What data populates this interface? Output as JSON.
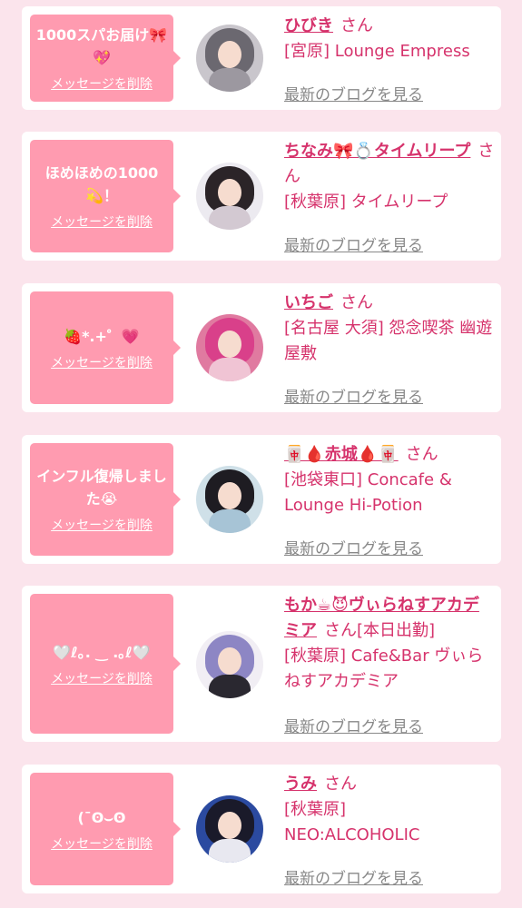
{
  "colors": {
    "background": "#fbe4ec",
    "bubble": "#ff9bb0",
    "accent": "#d6336c",
    "blog_link": "#888888"
  },
  "delete_label": "メッセージを削除",
  "san_label": "さん",
  "blog_label": "最新のブログを見る",
  "cards": [
    {
      "message": "1000スパお届け🎀💖",
      "name": "ひびき",
      "shop": "[宮原] Lounge Empress",
      "avatar": {
        "bg": "#c9c6cc",
        "hair": "#6b6870",
        "body": "#9c98a0"
      }
    },
    {
      "message": "ほめほめの1000💫！",
      "name": "ちなみ🎀💍タイムリープ",
      "shop": "[秋葉原] タイムリープ",
      "avatar": {
        "bg": "#eceaf0",
        "hair": "#2b2428",
        "body": "#d3c9d2"
      }
    },
    {
      "message": "🍓*.+゜💗",
      "name": "いちご",
      "shop": "[名古屋 大須] 怨念喫茶 幽遊屋敷",
      "avatar": {
        "bg": "#e07aa0",
        "hair": "#d9408a",
        "body": "#f0c4d4"
      }
    },
    {
      "message": "インフル復帰しました😭",
      "name": "🀄🩸赤城🩸🀄",
      "shop": "[池袋東口] Concafe & Lounge Hi-Potion",
      "avatar": {
        "bg": "#cfe0e8",
        "hair": "#1e1c22",
        "body": "#a7c4d6"
      }
    },
    {
      "message": "🤍ℓ｡. ‿ .｡ℓ🤍",
      "name": "もか☕😈ヴぃらねすアカデミア",
      "extra": "[本日出勤]",
      "shop": "[秋葉原] Cafe&Bar ヴぃらねすアカデミア",
      "avatar": {
        "bg": "#f1eef4",
        "hair": "#8d86c4",
        "body": "#2a2830"
      }
    },
    {
      "message": "(¯ʘ⌣ʘ",
      "name": "うみ",
      "shop": "[秋葉原] NEO:ALCOHOLIC",
      "avatar": {
        "bg": "#2b4aa0",
        "hair": "#1a1a2a",
        "body": "#e8e8f0"
      }
    }
  ]
}
